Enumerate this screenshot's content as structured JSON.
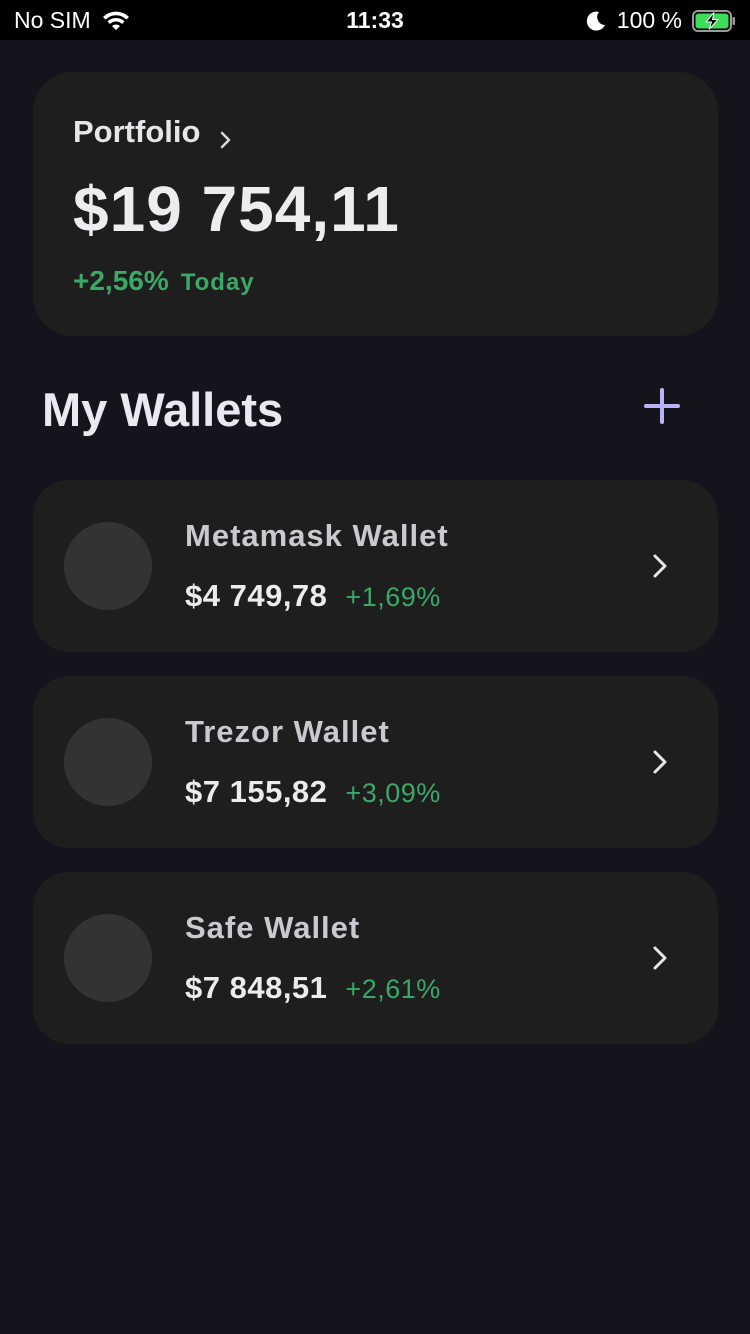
{
  "status_bar": {
    "carrier": "No SIM",
    "time": "11:33",
    "battery_percent": "100 %",
    "icons": [
      "wifi-icon",
      "moon-icon",
      "battery-charging-icon"
    ]
  },
  "portfolio": {
    "label": "Portfolio",
    "total": "$19 754,11",
    "change_percent": "+2,56%",
    "change_period": "Today",
    "icon": "chevron-right-icon"
  },
  "wallets_section": {
    "title": "My Wallets",
    "add_icon": "plus-icon"
  },
  "wallets": [
    {
      "name": "Metamask Wallet",
      "balance": "$4 749,78",
      "change": "+1,69%"
    },
    {
      "name": "Trezor Wallet",
      "balance": "$7 155,82",
      "change": "+3,09%"
    },
    {
      "name": "Safe Wallet",
      "balance": "$7 848,51",
      "change": "+2,61%"
    }
  ],
  "colors": {
    "background": "#15141d",
    "card": "#1e1e1e",
    "positive": "#3aa867",
    "accent": "#b9b4f5"
  }
}
